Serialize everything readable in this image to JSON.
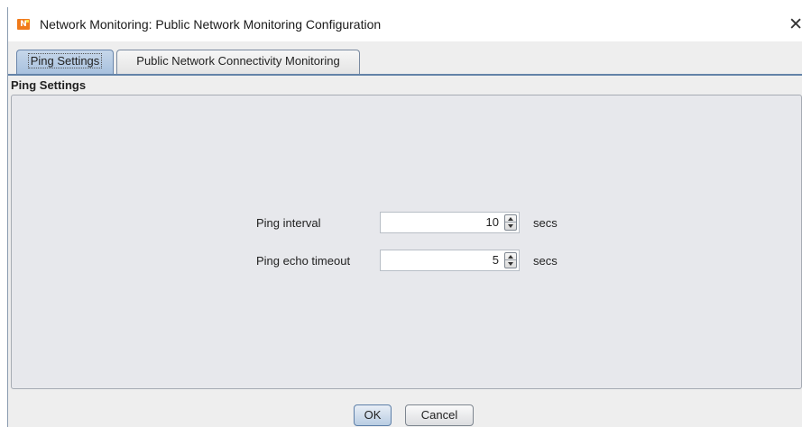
{
  "window": {
    "title": "Network Monitoring: Public Network Monitoring Configuration",
    "app_icon_text": "N"
  },
  "tabs": [
    {
      "label": "Ping Settings",
      "active": true
    },
    {
      "label": "Public Network Connectivity Monitoring",
      "active": false
    }
  ],
  "panel": {
    "header": "Ping Settings"
  },
  "fields": [
    {
      "label": "Ping interval",
      "value": "10",
      "unit": "secs"
    },
    {
      "label": "Ping echo timeout",
      "value": "5",
      "unit": "secs"
    }
  ],
  "buttons": {
    "ok_label": "OK",
    "cancel_label": "Cancel"
  },
  "colors": {
    "active_tab": "#a8c1de",
    "tab_underline": "#6383a8",
    "app_icon": "#f07a1a"
  }
}
